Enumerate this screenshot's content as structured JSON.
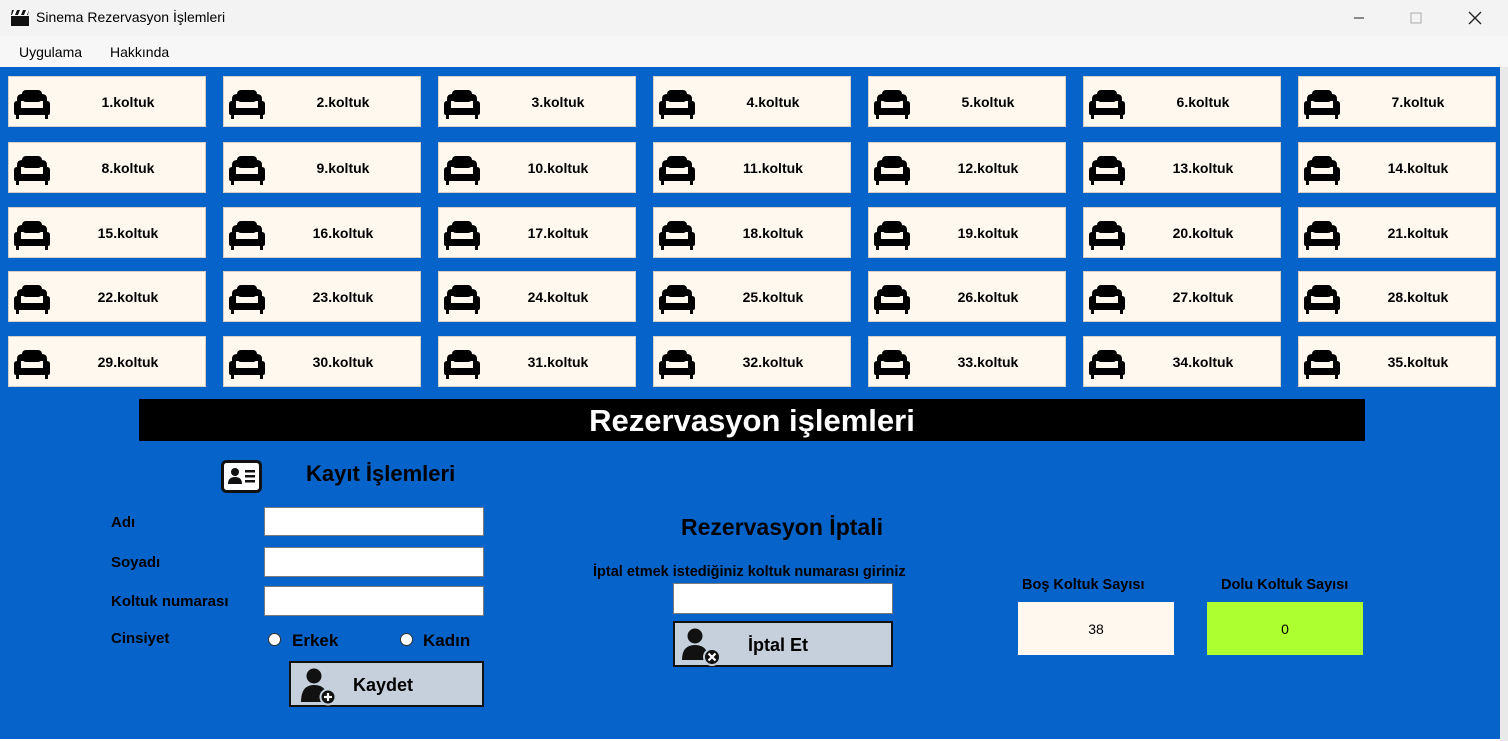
{
  "window": {
    "title": "Sinema Rezervasyon İşlemleri",
    "minimize_icon": "minimize-icon",
    "maximize_icon": "maximize-icon",
    "close_icon": "close-icon"
  },
  "menu": [
    "Uygulama",
    "Hakkında"
  ],
  "seats": [
    "1.koltuk",
    "2.koltuk",
    "3.koltuk",
    "4.koltuk",
    "5.koltuk",
    "6.koltuk",
    "7.koltuk",
    "8.koltuk",
    "9.koltuk",
    "10.koltuk",
    "11.koltuk",
    "12.koltuk",
    "13.koltuk",
    "14.koltuk",
    "15.koltuk",
    "16.koltuk",
    "17.koltuk",
    "18.koltuk",
    "19.koltuk",
    "20.koltuk",
    "21.koltuk",
    "22.koltuk",
    "23.koltuk",
    "24.koltuk",
    "25.koltuk",
    "26.koltuk",
    "27.koltuk",
    "28.koltuk",
    "29.koltuk",
    "30.koltuk",
    "31.koltuk",
    "32.koltuk",
    "33.koltuk",
    "34.koltuk",
    "35.koltuk"
  ],
  "banner": "Rezervasyon işlemleri",
  "kayit": {
    "title": "Kayıt İşlemleri",
    "ad_label": "Adı",
    "ad_value": "",
    "soyad_label": "Soyadı",
    "soyad_value": "",
    "koltuk_label": "Koltuk numarası",
    "koltuk_value": "",
    "cinsiyet_label": "Cinsiyet",
    "erkek_label": "Erkek",
    "kadin_label": "Kadın",
    "kaydet_label": "Kaydet"
  },
  "iptal": {
    "title": "Rezervasyon İptali",
    "prompt": "İptal etmek istediğiniz koltuk numarası giriniz",
    "input_value": "",
    "button_label": "İptal Et"
  },
  "stats": {
    "bos_label": "Boş Koltuk Sayısı",
    "bos_value": "38",
    "dolu_label": "Dolu Koltuk Sayısı",
    "dolu_value": "0"
  },
  "colors": {
    "background": "#0563c9",
    "seat_bg": "#fff8ee",
    "dolu_bg": "#adff2f",
    "button_bg": "#c5d0dc"
  }
}
